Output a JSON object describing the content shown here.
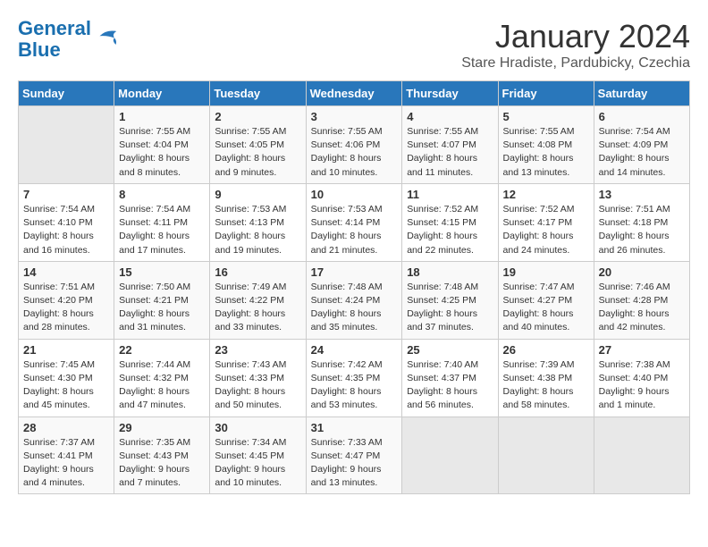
{
  "header": {
    "logo_line1": "General",
    "logo_line2": "Blue",
    "month_title": "January 2024",
    "subtitle": "Stare Hradiste, Pardubicky, Czechia"
  },
  "weekdays": [
    "Sunday",
    "Monday",
    "Tuesday",
    "Wednesday",
    "Thursday",
    "Friday",
    "Saturday"
  ],
  "weeks": [
    [
      {
        "day": "",
        "info": ""
      },
      {
        "day": "1",
        "info": "Sunrise: 7:55 AM\nSunset: 4:04 PM\nDaylight: 8 hours\nand 8 minutes."
      },
      {
        "day": "2",
        "info": "Sunrise: 7:55 AM\nSunset: 4:05 PM\nDaylight: 8 hours\nand 9 minutes."
      },
      {
        "day": "3",
        "info": "Sunrise: 7:55 AM\nSunset: 4:06 PM\nDaylight: 8 hours\nand 10 minutes."
      },
      {
        "day": "4",
        "info": "Sunrise: 7:55 AM\nSunset: 4:07 PM\nDaylight: 8 hours\nand 11 minutes."
      },
      {
        "day": "5",
        "info": "Sunrise: 7:55 AM\nSunset: 4:08 PM\nDaylight: 8 hours\nand 13 minutes."
      },
      {
        "day": "6",
        "info": "Sunrise: 7:54 AM\nSunset: 4:09 PM\nDaylight: 8 hours\nand 14 minutes."
      }
    ],
    [
      {
        "day": "7",
        "info": "Sunrise: 7:54 AM\nSunset: 4:10 PM\nDaylight: 8 hours\nand 16 minutes."
      },
      {
        "day": "8",
        "info": "Sunrise: 7:54 AM\nSunset: 4:11 PM\nDaylight: 8 hours\nand 17 minutes."
      },
      {
        "day": "9",
        "info": "Sunrise: 7:53 AM\nSunset: 4:13 PM\nDaylight: 8 hours\nand 19 minutes."
      },
      {
        "day": "10",
        "info": "Sunrise: 7:53 AM\nSunset: 4:14 PM\nDaylight: 8 hours\nand 21 minutes."
      },
      {
        "day": "11",
        "info": "Sunrise: 7:52 AM\nSunset: 4:15 PM\nDaylight: 8 hours\nand 22 minutes."
      },
      {
        "day": "12",
        "info": "Sunrise: 7:52 AM\nSunset: 4:17 PM\nDaylight: 8 hours\nand 24 minutes."
      },
      {
        "day": "13",
        "info": "Sunrise: 7:51 AM\nSunset: 4:18 PM\nDaylight: 8 hours\nand 26 minutes."
      }
    ],
    [
      {
        "day": "14",
        "info": "Sunrise: 7:51 AM\nSunset: 4:20 PM\nDaylight: 8 hours\nand 28 minutes."
      },
      {
        "day": "15",
        "info": "Sunrise: 7:50 AM\nSunset: 4:21 PM\nDaylight: 8 hours\nand 31 minutes."
      },
      {
        "day": "16",
        "info": "Sunrise: 7:49 AM\nSunset: 4:22 PM\nDaylight: 8 hours\nand 33 minutes."
      },
      {
        "day": "17",
        "info": "Sunrise: 7:48 AM\nSunset: 4:24 PM\nDaylight: 8 hours\nand 35 minutes."
      },
      {
        "day": "18",
        "info": "Sunrise: 7:48 AM\nSunset: 4:25 PM\nDaylight: 8 hours\nand 37 minutes."
      },
      {
        "day": "19",
        "info": "Sunrise: 7:47 AM\nSunset: 4:27 PM\nDaylight: 8 hours\nand 40 minutes."
      },
      {
        "day": "20",
        "info": "Sunrise: 7:46 AM\nSunset: 4:28 PM\nDaylight: 8 hours\nand 42 minutes."
      }
    ],
    [
      {
        "day": "21",
        "info": "Sunrise: 7:45 AM\nSunset: 4:30 PM\nDaylight: 8 hours\nand 45 minutes."
      },
      {
        "day": "22",
        "info": "Sunrise: 7:44 AM\nSunset: 4:32 PM\nDaylight: 8 hours\nand 47 minutes."
      },
      {
        "day": "23",
        "info": "Sunrise: 7:43 AM\nSunset: 4:33 PM\nDaylight: 8 hours\nand 50 minutes."
      },
      {
        "day": "24",
        "info": "Sunrise: 7:42 AM\nSunset: 4:35 PM\nDaylight: 8 hours\nand 53 minutes."
      },
      {
        "day": "25",
        "info": "Sunrise: 7:40 AM\nSunset: 4:37 PM\nDaylight: 8 hours\nand 56 minutes."
      },
      {
        "day": "26",
        "info": "Sunrise: 7:39 AM\nSunset: 4:38 PM\nDaylight: 8 hours\nand 58 minutes."
      },
      {
        "day": "27",
        "info": "Sunrise: 7:38 AM\nSunset: 4:40 PM\nDaylight: 9 hours\nand 1 minute."
      }
    ],
    [
      {
        "day": "28",
        "info": "Sunrise: 7:37 AM\nSunset: 4:41 PM\nDaylight: 9 hours\nand 4 minutes."
      },
      {
        "day": "29",
        "info": "Sunrise: 7:35 AM\nSunset: 4:43 PM\nDaylight: 9 hours\nand 7 minutes."
      },
      {
        "day": "30",
        "info": "Sunrise: 7:34 AM\nSunset: 4:45 PM\nDaylight: 9 hours\nand 10 minutes."
      },
      {
        "day": "31",
        "info": "Sunrise: 7:33 AM\nSunset: 4:47 PM\nDaylight: 9 hours\nand 13 minutes."
      },
      {
        "day": "",
        "info": ""
      },
      {
        "day": "",
        "info": ""
      },
      {
        "day": "",
        "info": ""
      }
    ]
  ]
}
